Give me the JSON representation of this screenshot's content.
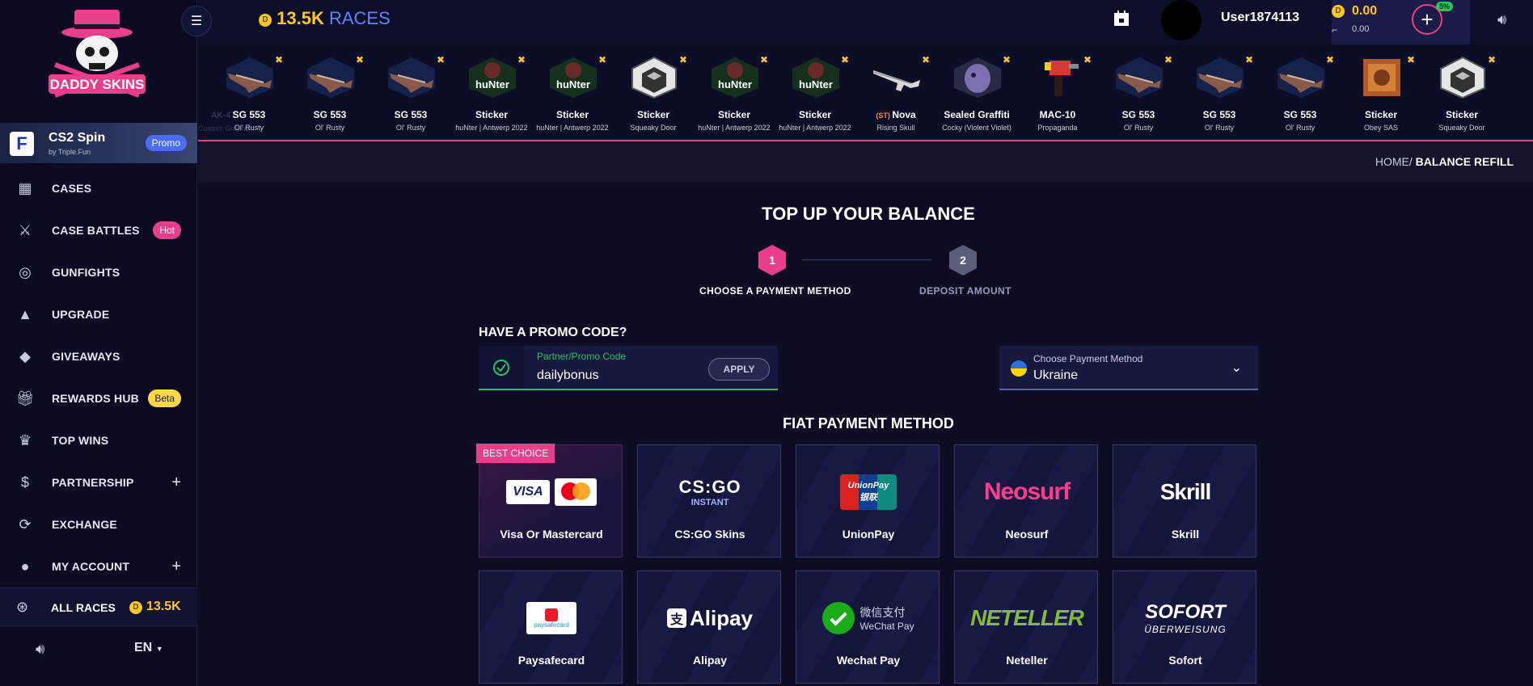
{
  "sidebar": {
    "promo": {
      "title": "CS2 Spin",
      "sub": "by Triple.Fun",
      "badge": "Promo",
      "icon": "F"
    },
    "items": [
      {
        "label": "CASES",
        "icon": "cases-icon"
      },
      {
        "label": "CASE BATTLES",
        "icon": "swords-icon",
        "pill": "Hot"
      },
      {
        "label": "GUNFIGHTS",
        "icon": "crosshair-icon"
      },
      {
        "label": "UPGRADE",
        "icon": "upgrade-icon"
      },
      {
        "label": "GIVEAWAYS",
        "icon": "diamond-icon"
      },
      {
        "label": "REWARDS HUB",
        "icon": "gift-icon",
        "pill": "Beta"
      },
      {
        "label": "TOP WINS",
        "icon": "trophy-icon"
      },
      {
        "label": "PARTNERSHIP",
        "icon": "dollar-icon",
        "expand": "+"
      },
      {
        "label": "EXCHANGE",
        "icon": "exchange-icon"
      },
      {
        "label": "MY ACCOUNT",
        "icon": "user-icon",
        "expand": "+"
      }
    ],
    "races": {
      "label": "ALL RACES",
      "value": "13.5K"
    },
    "language": "EN"
  },
  "header": {
    "races_amount": "13.5K",
    "races_label": "RACES",
    "username": "User1874113",
    "balance": "0.00",
    "secondary_balance": "0.00",
    "bonus": "5%",
    "coin_symbol": "D"
  },
  "drops": {
    "ghost": {
      "name": "AK-47",
      "sub": "Custom Grounds"
    },
    "items": [
      {
        "name": "SG 553",
        "sub": "Ol' Rusty",
        "kind": "rifle"
      },
      {
        "name": "SG 553",
        "sub": "Ol' Rusty",
        "kind": "rifle"
      },
      {
        "name": "SG 553",
        "sub": "Ol' Rusty",
        "kind": "rifle"
      },
      {
        "name": "Sticker",
        "sub": "huNter | Antwerp 2022",
        "kind": "hunter"
      },
      {
        "name": "Sticker",
        "sub": "huNter | Antwerp 2022",
        "kind": "hunter"
      },
      {
        "name": "Sticker",
        "sub": "Squeaky Door",
        "kind": "cube"
      },
      {
        "name": "Sticker",
        "sub": "huNter | Antwerp 2022",
        "kind": "hunter"
      },
      {
        "name": "Sticker",
        "sub": "huNter | Antwerp 2022",
        "kind": "hunter"
      },
      {
        "name": "Nova",
        "prefix": "(ST)",
        "sub": "Rising Skull",
        "kind": "shotgun"
      },
      {
        "name": "Sealed Graffiti",
        "sub": "Cocky (Violent Violet)",
        "kind": "graffiti"
      },
      {
        "name": "MAC-10",
        "sub": "Propaganda",
        "kind": "smg"
      },
      {
        "name": "SG 553",
        "sub": "Ol' Rusty",
        "kind": "rifle"
      },
      {
        "name": "SG 553",
        "sub": "Ol' Rusty",
        "kind": "rifle"
      },
      {
        "name": "SG 553",
        "sub": "Ol' Rusty",
        "kind": "rifle"
      },
      {
        "name": "Sticker",
        "sub": "Obey SAS",
        "kind": "obey"
      },
      {
        "name": "Sticker",
        "sub": "Squeaky Door",
        "kind": "cube"
      }
    ]
  },
  "breadcrumb": {
    "home": "HOME",
    "sep": "/",
    "current": "BALANCE REFILL"
  },
  "main": {
    "title": "TOP UP YOUR BALANCE",
    "steps": [
      {
        "num": "1",
        "label": "CHOOSE A PAYMENT METHOD",
        "active": true
      },
      {
        "num": "2",
        "label": "DEPOSIT AMOUNT",
        "active": false
      }
    ],
    "promo": {
      "heading": "HAVE A PROMO CODE?",
      "field_label": "Partner/Promo Code",
      "value": "dailybonus",
      "apply": "APPLY"
    },
    "method_select": {
      "label": "Choose Payment Method",
      "value": "Ukraine"
    },
    "fiat_title": "FIAT PAYMENT METHOD",
    "best_choice": "BEST CHOICE",
    "methods": [
      {
        "name": "Visa Or Mastercard",
        "logo": "visa-mastercard"
      },
      {
        "name": "CS:GO Skins",
        "logo": "csgo"
      },
      {
        "name": "UnionPay",
        "logo": "unionpay"
      },
      {
        "name": "Neosurf",
        "logo": "neosurf"
      },
      {
        "name": "Skrill",
        "logo": "skrill"
      },
      {
        "name": "Paysafecard",
        "logo": "paysafecard"
      },
      {
        "name": "Alipay",
        "logo": "alipay"
      },
      {
        "name": "Wechat Pay",
        "logo": "wechat"
      },
      {
        "name": "Neteller",
        "logo": "neteller"
      },
      {
        "name": "Sofort",
        "logo": "sofort"
      }
    ],
    "logo_text": {
      "visa": "VISA",
      "csgo": "CS:GO",
      "csgo_sub": "INSTANT",
      "unionpay": "UnionPay",
      "unionpay_cn": "银联",
      "neosurf": "Neosurf",
      "skrill": "Skrill",
      "paysafe": "paysafecard",
      "alipay": "Alipay",
      "wechat_cn": "微信支付",
      "wechat_en": "WeChat Pay",
      "neteller": "NETELLER",
      "sofort": "SOFORT",
      "sofort_sub": "ÜBERWEISUNG"
    }
  },
  "colors": {
    "accent": "#e83e8c",
    "gold": "#ffc629",
    "green": "#22c55e",
    "blue": "#5f86ff",
    "bg": "#0d0e26"
  }
}
